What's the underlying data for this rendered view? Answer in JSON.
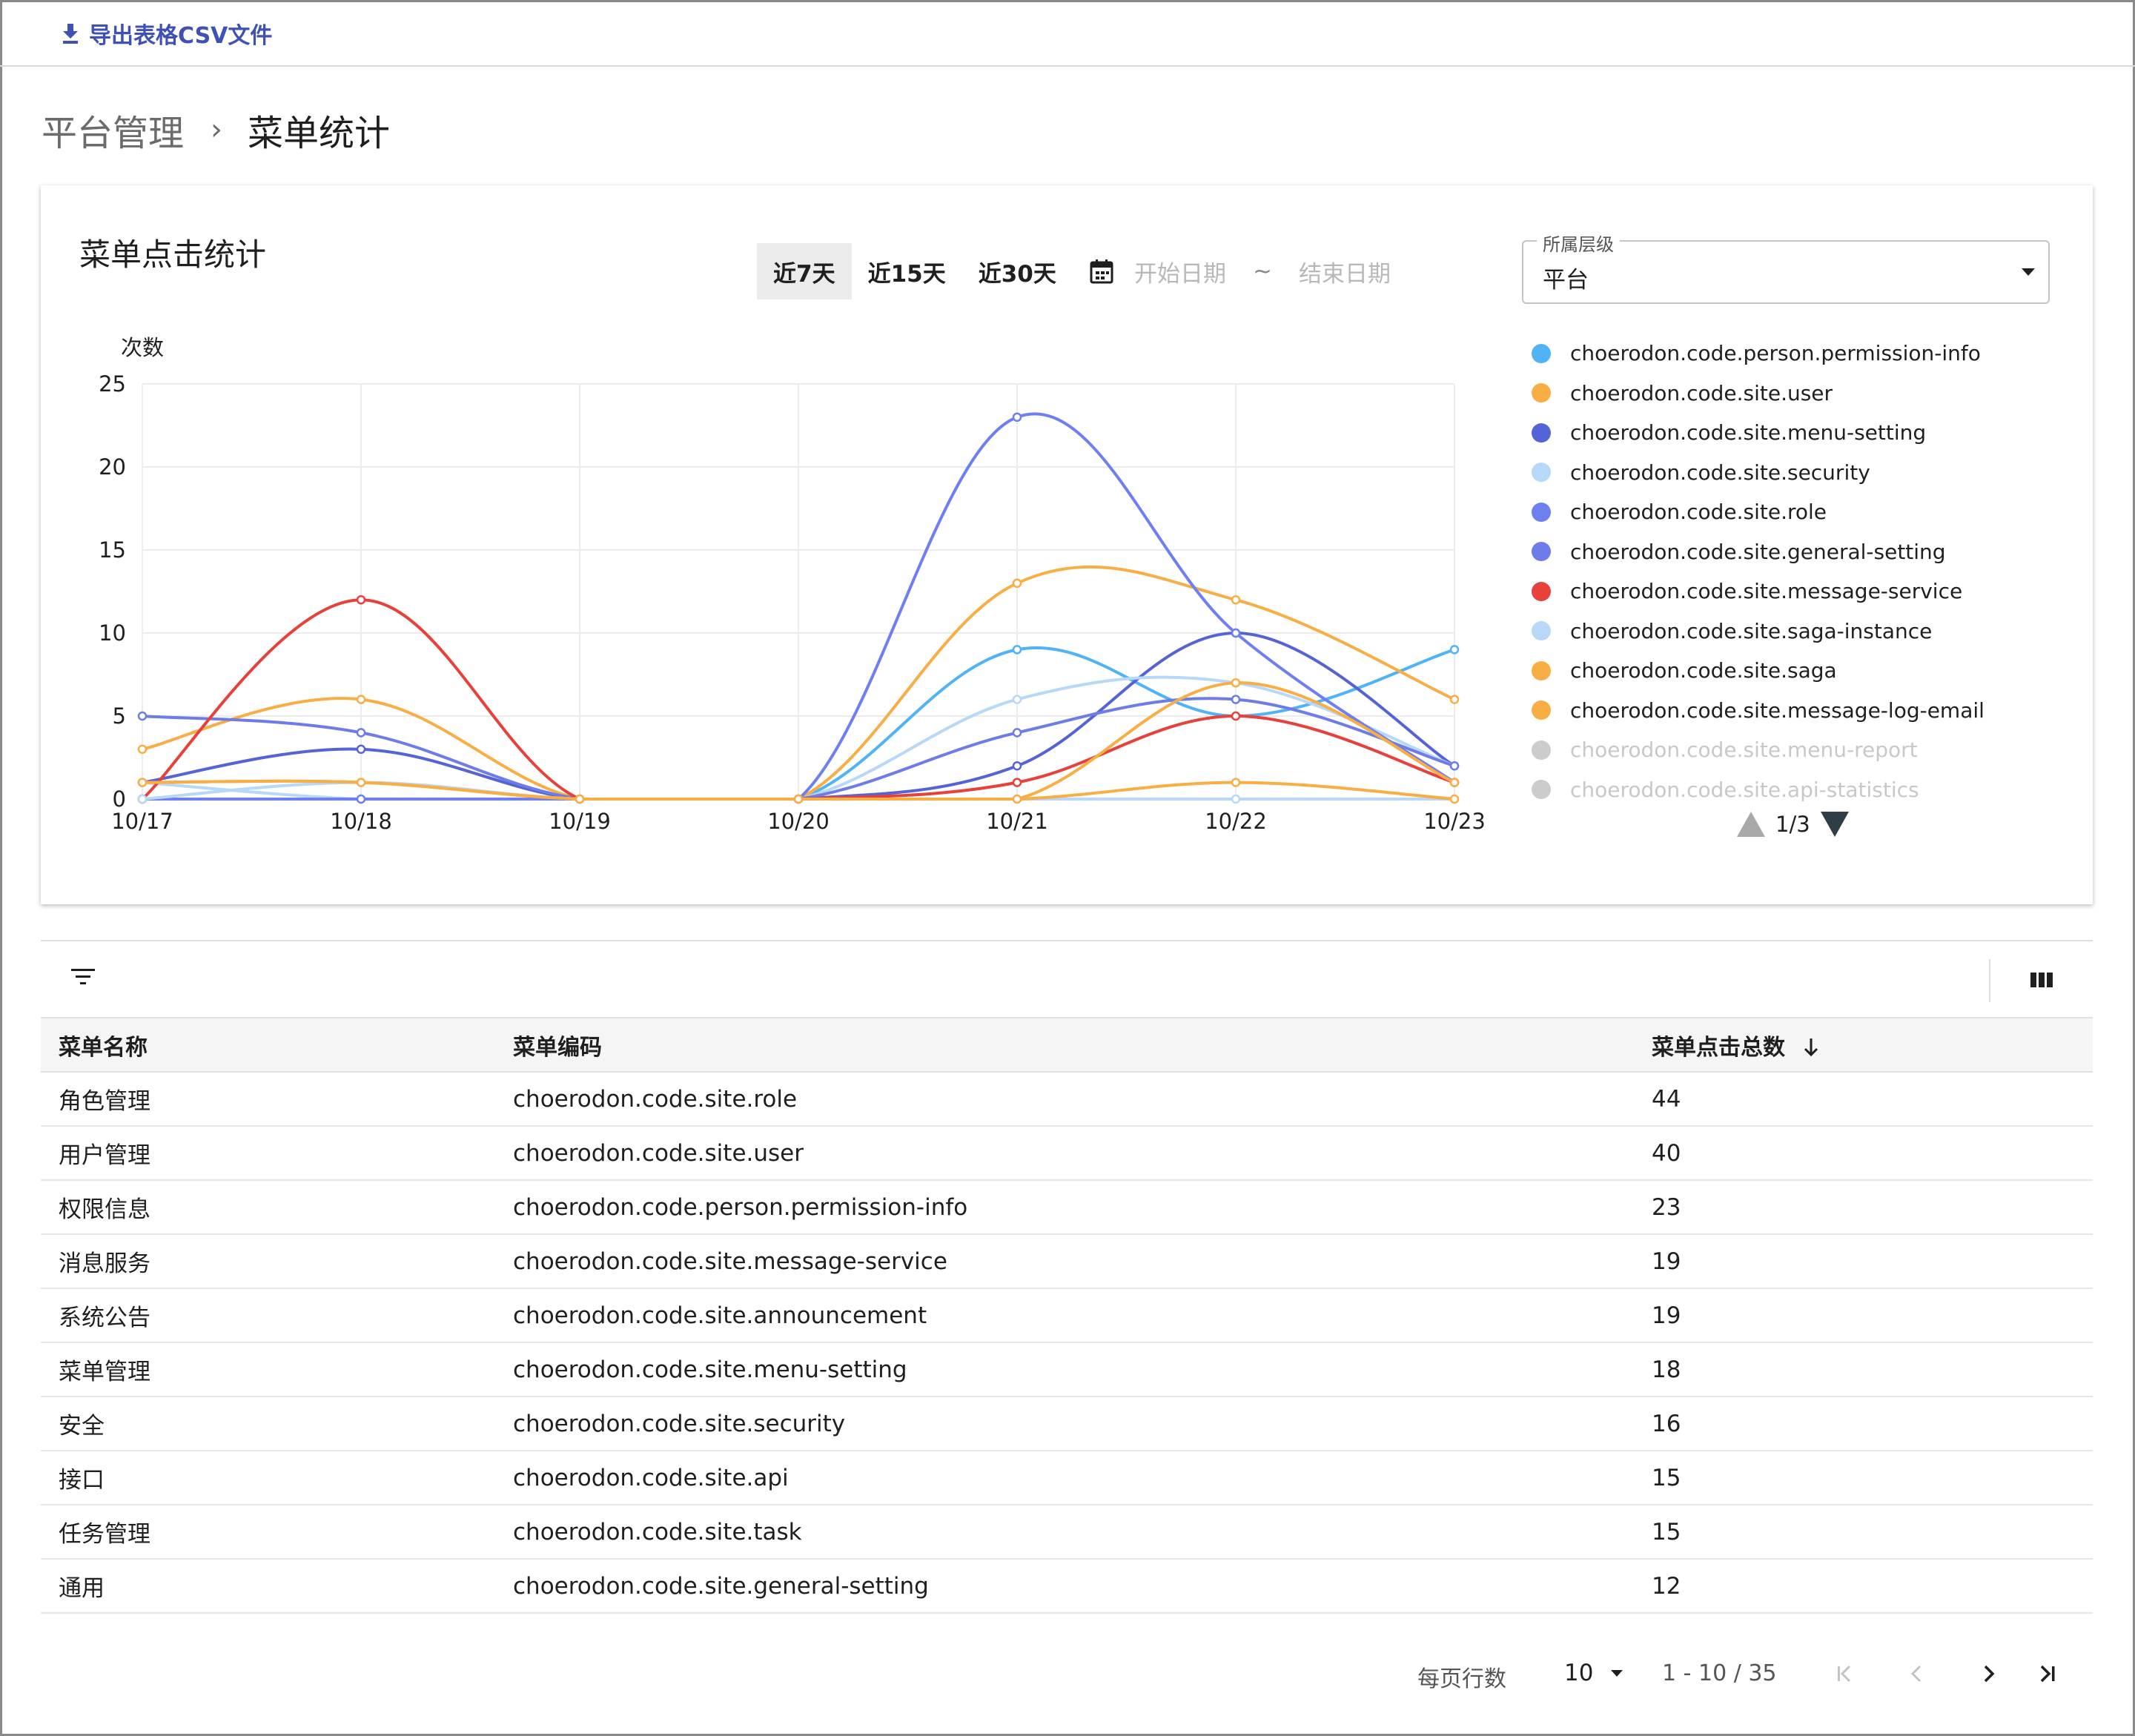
{
  "toolbar": {
    "export_label": "导出表格CSV文件"
  },
  "breadcrumb": {
    "parent": "平台管理",
    "separator": "›",
    "current": "菜单统计"
  },
  "chart_card": {
    "title": "菜单点击统计",
    "ranges": [
      "近7天",
      "近15天",
      "近30天"
    ],
    "active_range": "近7天",
    "date_start_placeholder": "开始日期",
    "date_end_placeholder": "结束日期",
    "date_separator": "~",
    "level_select": {
      "label": "所属层级",
      "value": "平台"
    },
    "y_unit": "次数",
    "legend_page": "1/3"
  },
  "chart_data": {
    "type": "line",
    "smooth": true,
    "grid": true,
    "ylabel": "次数",
    "ylim": [
      0,
      25
    ],
    "yticks": [
      0,
      5,
      10,
      15,
      20,
      25
    ],
    "categories": [
      "10/17",
      "10/18",
      "10/19",
      "10/20",
      "10/21",
      "10/22",
      "10/23"
    ],
    "legend_position": "right",
    "series": [
      {
        "name": "choerodon.code.person.permission-info",
        "color": "#4fb3f6",
        "visible": true,
        "values": [
          0,
          0,
          0,
          0,
          9,
          5,
          9
        ]
      },
      {
        "name": "choerodon.code.site.user",
        "color": "#f9ae45",
        "visible": true,
        "values": [
          3,
          6,
          0,
          0,
          13,
          12,
          6
        ]
      },
      {
        "name": "choerodon.code.site.menu-setting",
        "color": "#5464d6",
        "visible": true,
        "values": [
          1,
          3,
          0,
          0,
          2,
          10,
          2
        ]
      },
      {
        "name": "choerodon.code.site.security",
        "color": "#b7d8f8",
        "visible": true,
        "values": [
          1,
          0,
          0,
          0,
          6,
          7,
          2
        ]
      },
      {
        "name": "choerodon.code.site.role",
        "color": "#6e7ff2",
        "visible": true,
        "values": [
          0,
          0,
          0,
          0,
          23,
          10,
          1
        ]
      },
      {
        "name": "choerodon.code.site.general-setting",
        "color": "#6d7ce8",
        "visible": true,
        "values": [
          5,
          4,
          0,
          0,
          4,
          6,
          2
        ]
      },
      {
        "name": "choerodon.code.site.message-service",
        "color": "#e8403a",
        "visible": true,
        "values": [
          0,
          12,
          0,
          0,
          1,
          5,
          1
        ]
      },
      {
        "name": "choerodon.code.site.saga-instance",
        "color": "#b9d7f7",
        "visible": true,
        "values": [
          0,
          1,
          0,
          0,
          0,
          0,
          0
        ]
      },
      {
        "name": "choerodon.code.site.saga",
        "color": "#f9ae45",
        "visible": true,
        "values": [
          1,
          1,
          0,
          0,
          0,
          7,
          1
        ]
      },
      {
        "name": "choerodon.code.site.message-log-email",
        "color": "#f9ae45",
        "visible": true,
        "values": [
          1,
          1,
          0,
          0,
          0,
          1,
          0
        ]
      },
      {
        "name": "choerodon.code.site.menu-report",
        "color": "#cccccc",
        "visible": false,
        "values": []
      },
      {
        "name": "choerodon.code.site.api-statistics",
        "color": "#cccccc",
        "visible": false,
        "values": []
      }
    ]
  },
  "table": {
    "columns": [
      "菜单名称",
      "菜单编码",
      "菜单点击总数"
    ],
    "rows": [
      {
        "name": "角色管理",
        "code": "choerodon.code.site.role",
        "count": "44"
      },
      {
        "name": "用户管理",
        "code": "choerodon.code.site.user",
        "count": "40"
      },
      {
        "name": "权限信息",
        "code": "choerodon.code.person.permission-info",
        "count": "23"
      },
      {
        "name": "消息服务",
        "code": "choerodon.code.site.message-service",
        "count": "19"
      },
      {
        "name": "系统公告",
        "code": "choerodon.code.site.announcement",
        "count": "19"
      },
      {
        "name": "菜单管理",
        "code": "choerodon.code.site.menu-setting",
        "count": "18"
      },
      {
        "name": "安全",
        "code": "choerodon.code.site.security",
        "count": "16"
      },
      {
        "name": "接口",
        "code": "choerodon.code.site.api",
        "count": "15"
      },
      {
        "name": "任务管理",
        "code": "choerodon.code.site.task",
        "count": "15"
      },
      {
        "name": "通用",
        "code": "choerodon.code.site.general-setting",
        "count": "12"
      }
    ]
  },
  "pagination": {
    "rows_per_page_label": "每页行数",
    "rows_per_page": "10",
    "range": "1 - 10 / 35"
  },
  "colors": {
    "accent": "#3f51b5"
  }
}
